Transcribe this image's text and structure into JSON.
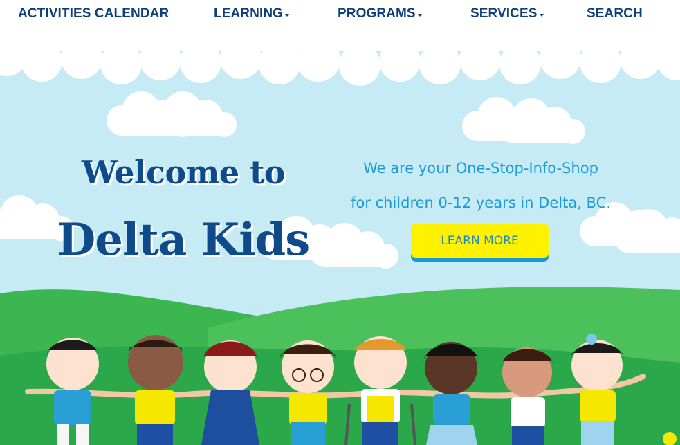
{
  "nav": {
    "items": [
      {
        "label": "ACTIVITIES CALENDAR",
        "has_dropdown": false
      },
      {
        "label": "LEARNING",
        "has_dropdown": true
      },
      {
        "label": "PROGRAMS",
        "has_dropdown": true
      },
      {
        "label": "SERVICES",
        "has_dropdown": true
      },
      {
        "label": "SEARCH",
        "has_dropdown": false
      }
    ]
  },
  "hero": {
    "welcome": "Welcome to",
    "brand": "Delta Kids",
    "tagline_line1": "We are your One-Stop-Info-Shop",
    "tagline_line2": "for children 0-12 years in Delta, BC.",
    "cta_label": "LEARN MORE"
  },
  "colors": {
    "nav_text": "#0e3f78",
    "sky": "#c6ebf5",
    "grass": "#2db34a",
    "heading": "#0f4a8a",
    "tagline": "#1a9bd7",
    "cta_bg": "#fff200"
  },
  "illustration": {
    "icon": "children-holding-hands-illustration",
    "children_count": 8
  }
}
